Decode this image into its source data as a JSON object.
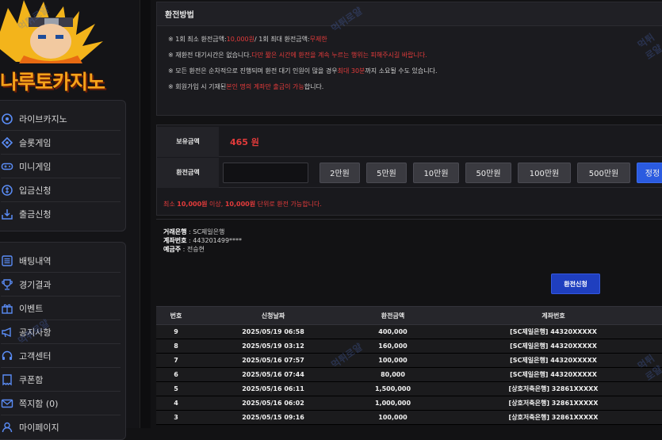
{
  "logo": {
    "text": "나루토카지노"
  },
  "watermark": "먹튀로얄",
  "sidebar": {
    "top_items": [
      {
        "label": "라이브카지노",
        "icon": "casino-chip-icon"
      },
      {
        "label": "슬롯게임",
        "icon": "slot-diamond-icon"
      },
      {
        "label": "미니게임",
        "icon": "gamepad-icon"
      },
      {
        "label": "입금신청",
        "icon": "deposit-coin-icon"
      },
      {
        "label": "출금신청",
        "icon": "withdraw-box-icon"
      }
    ],
    "bottom_items": [
      {
        "label": "배팅내역",
        "icon": "list-icon"
      },
      {
        "label": "경기결과",
        "icon": "trophy-icon"
      },
      {
        "label": "이벤트",
        "icon": "gift-icon"
      },
      {
        "label": "공지사항",
        "icon": "megaphone-icon"
      },
      {
        "label": "고객센터",
        "icon": "headset-icon"
      },
      {
        "label": "쿠폰함",
        "icon": "coupon-icon"
      },
      {
        "label": "쪽지함 (0)",
        "icon": "mail-icon"
      },
      {
        "label": "마이페이지",
        "icon": "user-icon"
      }
    ]
  },
  "guide": {
    "title": "환전방법",
    "lines": [
      {
        "parts": [
          {
            "t": "※ 1회 최소 환전금액: ",
            "red": false
          },
          {
            "t": "10,000원",
            "red": true
          },
          {
            "t": " / 1회 최대 환전금액: ",
            "red": false
          },
          {
            "t": "무제한",
            "red": true
          }
        ]
      },
      {
        "parts": [
          {
            "t": "※ 재환전 대기시간은 없습니다. ",
            "red": false
          },
          {
            "t": "다만 짧은 시간에 환전을 계속 누르는 행위는 피해주시길 바랍니다.",
            "red": true
          }
        ]
      },
      {
        "parts": [
          {
            "t": "※ 모든 환전은 순차적으로 진행되며 환전 대기 인원이 많을 경우 ",
            "red": false
          },
          {
            "t": "최대 30분",
            "red": true
          },
          {
            "t": " 까지 소요될 수도 있습니다.",
            "red": false
          }
        ]
      },
      {
        "parts": [
          {
            "t": "※ 회원가입 시 기재된 ",
            "red": false
          },
          {
            "t": "본인 명의 계좌만 출금이 가능",
            "red": true
          },
          {
            "t": " 합니다.",
            "red": false
          }
        ]
      }
    ]
  },
  "form": {
    "balance_label": "보유금액",
    "balance_value": "465 원",
    "amount_label": "환전금액",
    "amount_value": "",
    "amount_buttons": [
      "2만원",
      "5만원",
      "10만원",
      "50만원",
      "100만원",
      "500만원",
      "정정"
    ],
    "note_prefix": "최소 ",
    "note_min": "10,000원",
    "note_mid": " 이상, ",
    "note_unit": "10,000원",
    "note_suffix": " 단위로 환전 가능합니다."
  },
  "bank": {
    "bank_label": "거래은행",
    "bank_value": " : SC제일은행",
    "account_label": "계좌번호",
    "account_value": " : 443201499****",
    "holder_label": "예금주",
    "holder_value": " : 전승현"
  },
  "submit_label": "환전신청",
  "table": {
    "headers": [
      "번호",
      "신청날짜",
      "환전금액",
      "계좌번호"
    ],
    "rows": [
      [
        "9",
        "2025/05/19 06:58",
        "400,000",
        "[SC제일은행] 44320XXXXX"
      ],
      [
        "8",
        "2025/05/19 03:12",
        "160,000",
        "[SC제일은행] 44320XXXXX"
      ],
      [
        "7",
        "2025/05/16 07:57",
        "100,000",
        "[SC제일은행] 44320XXXXX"
      ],
      [
        "6",
        "2025/05/16 07:44",
        "80,000",
        "[SC제일은행] 44320XXXXX"
      ],
      [
        "5",
        "2025/05/16 06:11",
        "1,500,000",
        "[상호저축은행] 32861XXXXX"
      ],
      [
        "4",
        "2025/05/16 06:02",
        "1,000,000",
        "[상호저축은행] 32861XXXXX"
      ],
      [
        "3",
        "2025/05/15 09:16",
        "100,000",
        "[상호저축은행] 32861XXXXX"
      ]
    ]
  },
  "colors": {
    "accent_red": "#e33b3b",
    "button_blue": "#2b5be0",
    "logo_orange": "#f5a21a"
  }
}
